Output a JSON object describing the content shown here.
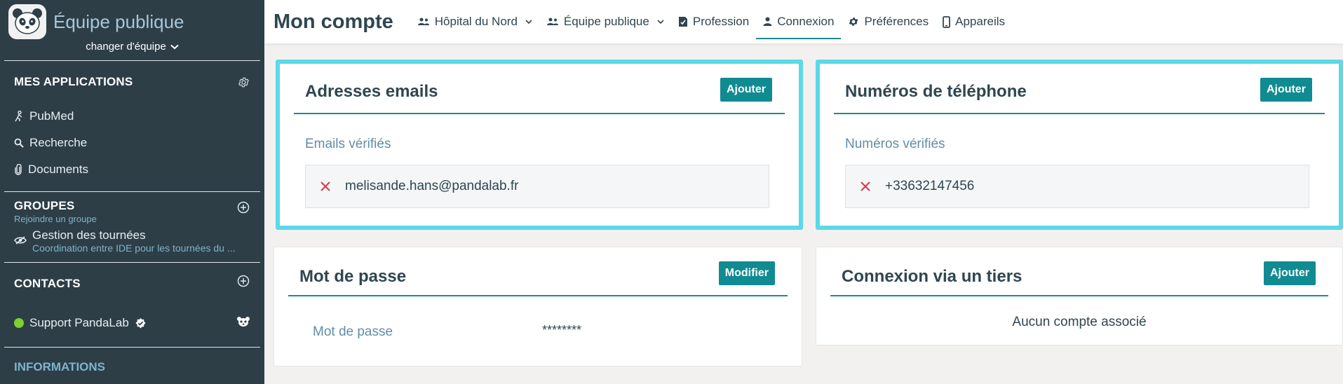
{
  "sidebar": {
    "team_name": "Équipe publique",
    "change_team": "changer d'équipe",
    "apps": {
      "title": "MES APPLICATIONS",
      "items": [
        {
          "label": "PubMed",
          "icon": "person-walking-icon"
        },
        {
          "label": "Recherche",
          "icon": "search-icon"
        },
        {
          "label": "Documents",
          "icon": "paperclip-icon"
        }
      ]
    },
    "groups": {
      "title": "GROUPES",
      "subtitle": "Rejoindre un groupe",
      "items": [
        {
          "name": "Gestion des tournées",
          "description": "Coordination entre IDE pour les tournées du ..."
        }
      ]
    },
    "contacts": {
      "title": "CONTACTS",
      "items": [
        {
          "name": "Support PandaLab",
          "status": "online"
        }
      ]
    },
    "informations": {
      "title": "INFORMATIONS"
    }
  },
  "header": {
    "title": "Mon compte",
    "tabs": [
      {
        "label": "Hôpital du Nord",
        "icon": "people-icon",
        "dropdown": true
      },
      {
        "label": "Équipe publique",
        "icon": "people-icon",
        "dropdown": true
      },
      {
        "label": "Profession",
        "icon": "badge-icon",
        "dropdown": false
      },
      {
        "label": "Connexion",
        "icon": "person-icon",
        "dropdown": false,
        "active": true
      },
      {
        "label": "Préférences",
        "icon": "gear-icon",
        "dropdown": false
      },
      {
        "label": "Appareils",
        "icon": "phone-icon",
        "dropdown": false
      }
    ]
  },
  "emails": {
    "title": "Adresses emails",
    "add_label": "Ajouter",
    "section_label": "Emails vérifiés",
    "items": [
      "melisande.hans@pandalab.fr"
    ]
  },
  "phones": {
    "title": "Numéros de téléphone",
    "add_label": "Ajouter",
    "section_label": "Numéros vérifiés",
    "items": [
      "+33632147456"
    ]
  },
  "password": {
    "title": "Mot de passe",
    "edit_label": "Modifier",
    "field_label": "Mot de passe",
    "value": "********"
  },
  "third_party": {
    "title": "Connexion via un tiers",
    "add_label": "Ajouter",
    "empty_text": "Aucun compte associé"
  },
  "colors": {
    "sidebar_bg": "#2d3e47",
    "accent": "#0f8b91",
    "highlight": "#5ad9e6",
    "danger": "#d9364b",
    "online": "#7fd12c"
  }
}
